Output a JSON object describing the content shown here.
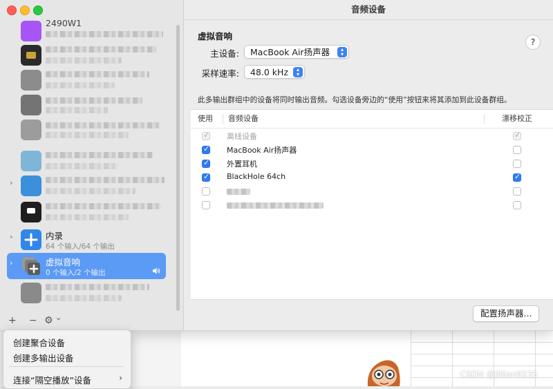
{
  "window": {
    "title": "音频设备"
  },
  "sidebar": {
    "devices": [
      {
        "name": "2490W1",
        "sub": "",
        "icon": "monitor-icon",
        "color": "#a855f7",
        "blurred": true
      },
      {
        "name": "",
        "sub": "",
        "icon": "blurred-icon",
        "color": "#333333",
        "blurred": true
      },
      {
        "name": "",
        "sub": "",
        "icon": "blurred-icon",
        "color": "#8a8a8a",
        "blurred": true
      },
      {
        "name": "",
        "sub": "",
        "icon": "blurred-icon",
        "color": "#6b6b6b",
        "blurred": true
      },
      {
        "name": "",
        "sub": "",
        "icon": "blurred-icon",
        "color": "#9a9a9a",
        "blurred": true
      },
      {
        "name": "",
        "sub": "",
        "icon": "blurred-icon",
        "color": "#7fb6d8",
        "blurred": true
      },
      {
        "name": "",
        "sub": "",
        "icon": "blurred-icon",
        "color": "#3b8fdb",
        "blurred": true
      },
      {
        "name": "",
        "sub": "",
        "icon": "blurred-icon",
        "color": "#222222",
        "blurred": true
      },
      {
        "name": "内录",
        "sub": "64 个输入/64 个输出",
        "icon": "aggregate-device-icon",
        "color": "#2f87e8",
        "blurred": false
      },
      {
        "name": "虚拟音响",
        "sub": "0 个输入/2 个输出",
        "icon": "multi-output-device-icon",
        "color": "#6b6b6b",
        "blurred": false,
        "selected": true
      },
      {
        "name": "",
        "sub": "",
        "icon": "blurred-icon",
        "color": "#888888",
        "blurred": true
      }
    ],
    "toolbar": {
      "add": "+",
      "remove": "−",
      "action": "⚙︎",
      "action_chevron": "⌄"
    }
  },
  "main": {
    "section_title": "虚拟音响",
    "help": "?",
    "master_label": "主设备:",
    "master_value": "MacBook Air扬声器",
    "rate_label": "采样速率:",
    "rate_value": "48.0 kHz",
    "description": "此多输出群组中的设备将同时输出音频。勾选设备旁边的“使用”按钮来将其添加到此设备群组。",
    "table": {
      "headers": [
        "使用",
        "音频设备",
        "漂移校正"
      ],
      "rows": [
        {
          "name": "离线设备",
          "use": "disabled-checked",
          "drift": "disabled-checked",
          "dim": true
        },
        {
          "name": "MacBook Air扬声器",
          "use": "checked",
          "drift": "unchecked",
          "dim": false
        },
        {
          "name": "外置耳机",
          "use": "checked",
          "drift": "unchecked",
          "dim": false
        },
        {
          "name": "BlackHole 64ch",
          "use": "checked",
          "drift": "checked",
          "dim": false
        },
        {
          "name": "",
          "use": "unchecked",
          "drift": "unchecked",
          "dim": false,
          "blurred": true
        },
        {
          "name": "",
          "use": "unchecked",
          "drift": "unchecked",
          "dim": false,
          "blurred": true
        }
      ]
    },
    "config_button": "配置扬声器..."
  },
  "context_menu": {
    "items": [
      "创建聚合设备",
      "创建多输出设备",
      "连接“隔空播放”设备"
    ],
    "submenu_arrow": "›"
  },
  "watermark": "CSDN @Jillian9235",
  "colors": {
    "accent": "#2f7bf6",
    "selection": "#5b9af5"
  }
}
